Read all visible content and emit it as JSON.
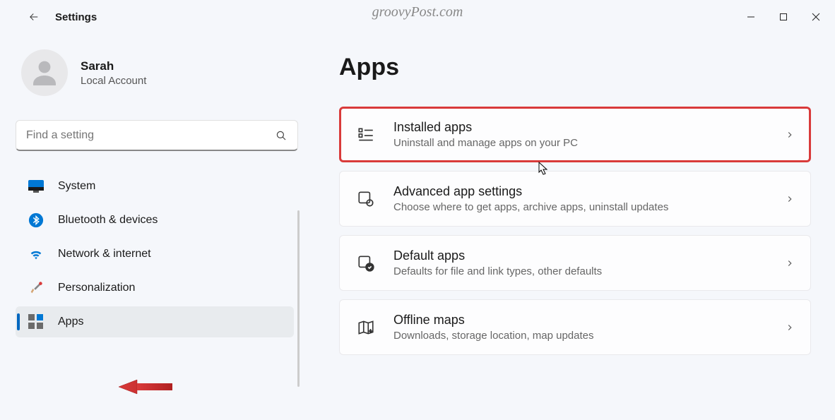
{
  "header": {
    "app_title": "Settings",
    "watermark": "groovyPost.com"
  },
  "user": {
    "name": "Sarah",
    "subtitle": "Local Account"
  },
  "search": {
    "placeholder": "Find a setting"
  },
  "sidebar": {
    "items": [
      {
        "label": "System"
      },
      {
        "label": "Bluetooth & devices"
      },
      {
        "label": "Network & internet"
      },
      {
        "label": "Personalization"
      },
      {
        "label": "Apps"
      }
    ],
    "active_index": 4
  },
  "main": {
    "title": "Apps",
    "cards": [
      {
        "title": "Installed apps",
        "subtitle": "Uninstall and manage apps on your PC",
        "highlight": true
      },
      {
        "title": "Advanced app settings",
        "subtitle": "Choose where to get apps, archive apps, uninstall updates",
        "highlight": false
      },
      {
        "title": "Default apps",
        "subtitle": "Defaults for file and link types, other defaults",
        "highlight": false
      },
      {
        "title": "Offline maps",
        "subtitle": "Downloads, storage location, map updates",
        "highlight": false
      }
    ]
  }
}
